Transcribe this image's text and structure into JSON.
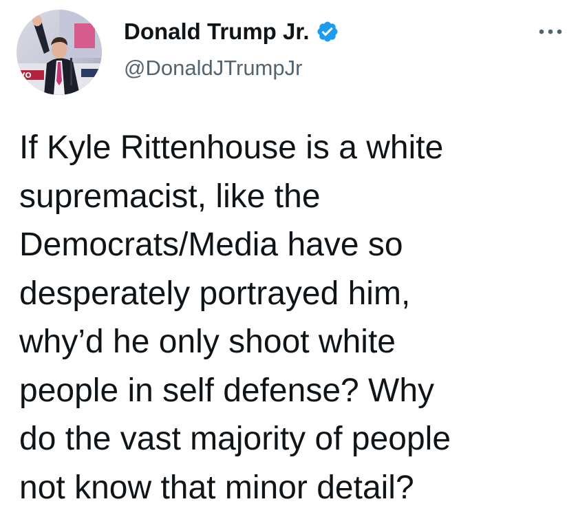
{
  "author": {
    "display_name": "Donald Trump Jr.",
    "handle": "@DonaldJTrumpJr",
    "verified": true,
    "avatar_icon": "profile-photo"
  },
  "more_icon": "ellipsis-icon",
  "tweet": {
    "lines": [
      "If Kyle Rittenhouse is a white",
      "supremacist, like the",
      "Democrats/Media have so",
      "desperately portrayed him,",
      "why’d he only shoot white",
      "people in self defense? Why",
      "do the vast majority of people",
      "not know that minor detail?"
    ]
  },
  "colors": {
    "verified_badge": "#1d9bf0",
    "handle_text": "#536471",
    "body_text": "#0f1419",
    "more_icon": "#536471"
  }
}
